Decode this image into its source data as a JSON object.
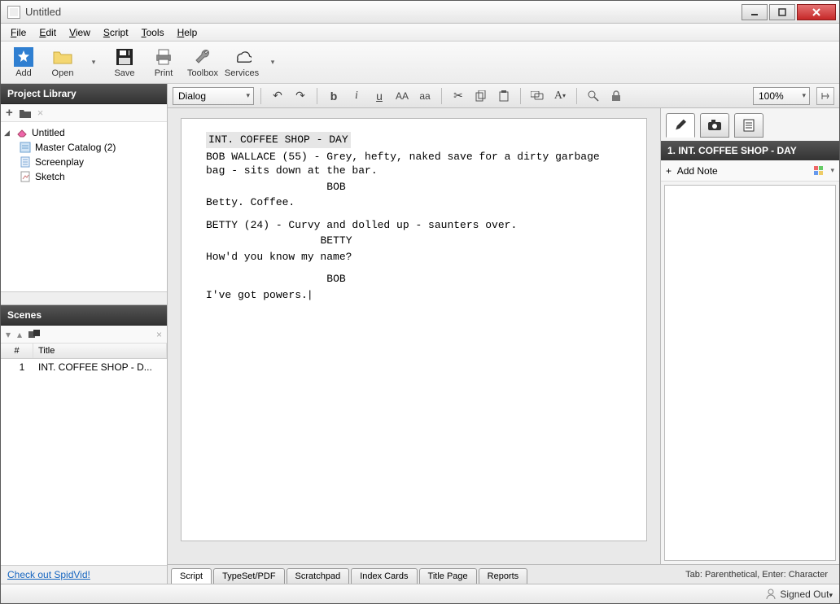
{
  "window": {
    "title": "Untitled"
  },
  "menu": {
    "file": "File",
    "edit": "Edit",
    "view": "View",
    "script": "Script",
    "tools": "Tools",
    "help": "Help"
  },
  "toolbar": {
    "add": "Add",
    "open": "Open",
    "save": "Save",
    "print": "Print",
    "toolbox": "Toolbox",
    "services": "Services"
  },
  "project_library": {
    "title": "Project Library",
    "root": "Untitled",
    "items": [
      "Master Catalog (2)",
      "Screenplay",
      "Sketch"
    ]
  },
  "scenes": {
    "title": "Scenes",
    "col_num": "#",
    "col_title": "Title",
    "rows": [
      {
        "num": "1",
        "title": "INT. COFFEE SHOP - D..."
      }
    ]
  },
  "footer_link": "Check out SpidVid!",
  "editor": {
    "style_combo": "Dialog",
    "zoom": "100%",
    "slug": "INT. COFFEE SHOP - DAY",
    "action1": "BOB WALLACE (55) - Grey, hefty, naked save for a dirty garbage bag - sits down at the bar.",
    "char1": "BOB",
    "dlg1": "Betty.  Coffee.",
    "action2": "BETTY (24) - Curvy and dolled up - saunters over.",
    "char2": "BETTY",
    "dlg2": "How'd you know my name?",
    "char3": "BOB",
    "dlg3": "I've got powers."
  },
  "notes": {
    "heading": "1. INT. COFFEE SHOP - DAY",
    "add": "Add Note"
  },
  "bottom_tabs": {
    "script": "Script",
    "typeset": "TypeSet/PDF",
    "scratch": "Scratchpad",
    "index": "Index Cards",
    "titlepage": "Title Page",
    "reports": "Reports"
  },
  "hint": "Tab: Parenthetical, Enter: Character",
  "status": "Signed Out"
}
